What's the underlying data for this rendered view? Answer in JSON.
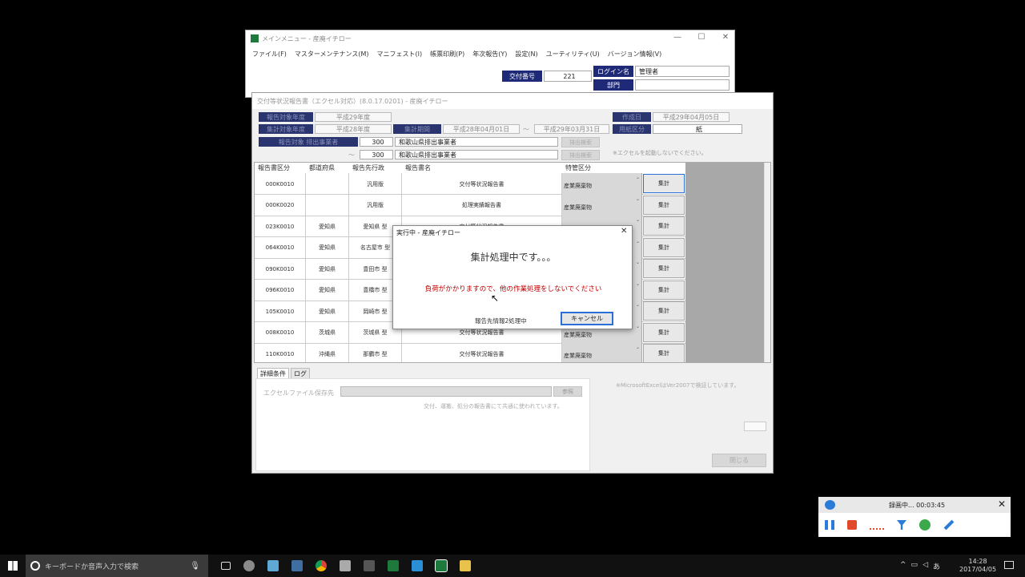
{
  "main_window": {
    "title": "メインメニュー - 産廃イチロー",
    "menu": [
      "ファイル(F)",
      "マスターメンテナンス(M)",
      "マニフェスト(I)",
      "帳票印刷(P)",
      "年次報告(Y)",
      "設定(N)",
      "ユーティリティ(U)",
      "バージョン情報(V)"
    ],
    "issue_no_label": "交付番号",
    "issue_no_value": "221",
    "login_label": "ログイン名",
    "login_value": "管理者",
    "dept_label": "部門",
    "dept_value": ""
  },
  "report_window": {
    "title": "交付等状況報告書（エクセル対応）(8.0.17.0201) - 産廃イチロー",
    "row1_label": "報告対象年度",
    "row1_value": "平成29年度",
    "row2_label": "集計対象年度",
    "row2_value": "平成28年度",
    "period_label": "集計期間",
    "period_from": "平成28年04月01日",
    "period_sep": "～",
    "period_to": "平成29年03月31日",
    "date_label": "作成日",
    "date_value": "平成29年04月05日",
    "paper_label": "用紙区分",
    "paper_value": "紙",
    "operator_label": "報告対象 排出事業者",
    "op_from_code": "300",
    "op_from_name": "和歌山県排出事業者",
    "op_tilde": "～",
    "op_to_code": "300",
    "op_to_name": "和歌山県排出事業者",
    "search_btn1": "排出検索",
    "search_btn2": "排出検索",
    "excel_note": "※エクセルを起動しないでください。",
    "table_headers": [
      "報告書区分",
      "都道府県",
      "報告先行政",
      "報告書名",
      "特管区分"
    ],
    "rows": [
      {
        "code": "000K0010",
        "pref": "",
        "gov": "汎用版",
        "name": "交付等状況報告書",
        "kind": "産業廃棄物",
        "btn": "集計"
      },
      {
        "code": "000K0020",
        "pref": "",
        "gov": "汎用版",
        "name": "処理実績報告書",
        "kind": "産業廃棄物",
        "btn": "集計"
      },
      {
        "code": "023K0010",
        "pref": "愛知県",
        "gov": "愛知県 型",
        "name": "交付等状況報告書",
        "kind": "産業廃棄物",
        "btn": "集計"
      },
      {
        "code": "064K0010",
        "pref": "愛知県",
        "gov": "名古屋市 型",
        "name": "",
        "kind": "",
        "btn": "集計"
      },
      {
        "code": "090K0010",
        "pref": "愛知県",
        "gov": "豊田市 型",
        "name": "",
        "kind": "",
        "btn": "集計"
      },
      {
        "code": "096K0010",
        "pref": "愛知県",
        "gov": "豊橋市 型",
        "name": "",
        "kind": "",
        "btn": "集計"
      },
      {
        "code": "105K0010",
        "pref": "愛知県",
        "gov": "岡崎市 型",
        "name": "",
        "kind": "",
        "btn": "集計"
      },
      {
        "code": "008K0010",
        "pref": "茨城県",
        "gov": "茨城県 型",
        "name": "交付等状況報告書",
        "kind": "産業廃棄物",
        "btn": "集計"
      },
      {
        "code": "110K0010",
        "pref": "沖縄県",
        "gov": "那覇市 型",
        "name": "交付等状況報告書",
        "kind": "産業廃棄物",
        "btn": "集計"
      }
    ],
    "tab_detail": "詳細条件",
    "tab_log": "ログ",
    "excel_path_label": "エクセルファイル保存先",
    "browse_btn": "参照",
    "shared_note": "交付、運搬、処分の報告書にて共通に使われています。",
    "excel_ver_note": "※MicrosoftExcelはVer2007で検証しています。",
    "close_btn": "閉じる"
  },
  "dialog": {
    "title": "実行中 - 産廃イチロー",
    "message": "集計処理中です。。。",
    "warning": "負荷がかかりますので、他の作業処理をしないでください",
    "status": "報告先情報2処理中",
    "cancel": "キャンセル"
  },
  "recorder": {
    "status": "録画中... 00:03:45"
  },
  "taskbar": {
    "search_placeholder": "キーボードか音声入力で検索",
    "time": "14:28",
    "date": "2017/04/05"
  },
  "colors": {
    "navy_label": "#1e2a78",
    "warning_text": "#c00000",
    "excel_green": "#1e7a3c"
  }
}
